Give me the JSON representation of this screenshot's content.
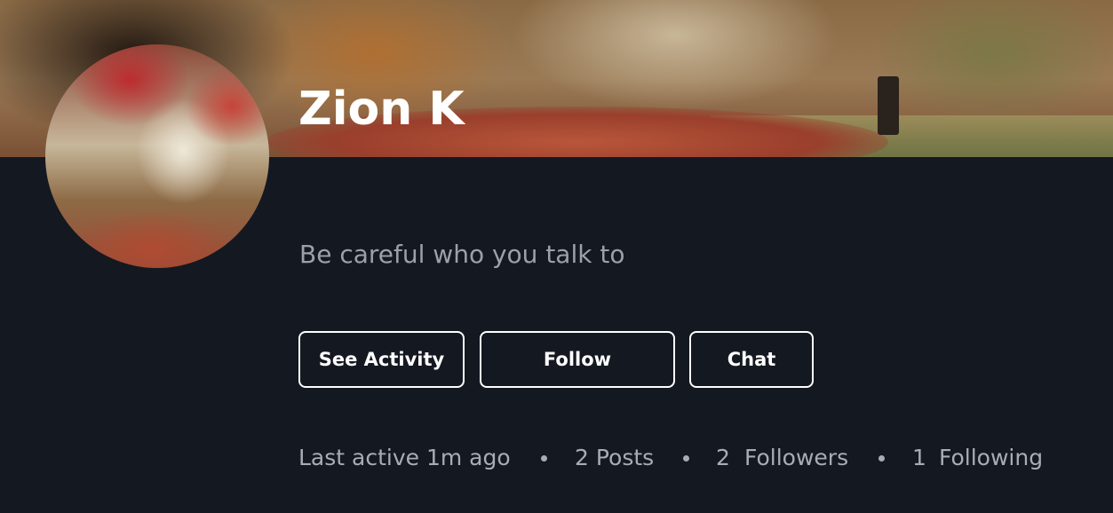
{
  "profile": {
    "name": "Zion K",
    "bio": "Be careful who you talk to"
  },
  "actions": {
    "see_activity": "See Activity",
    "follow": "Follow",
    "chat": "Chat"
  },
  "stats": {
    "last_active": "Last active 1m ago",
    "posts": "2 Posts",
    "followers_count": "2",
    "followers_label": "Followers",
    "following_count": "1",
    "following_label": "Following"
  },
  "colors": {
    "background": "#141821",
    "button_border": "#ffffff",
    "muted_text": "#9ba0a9"
  }
}
